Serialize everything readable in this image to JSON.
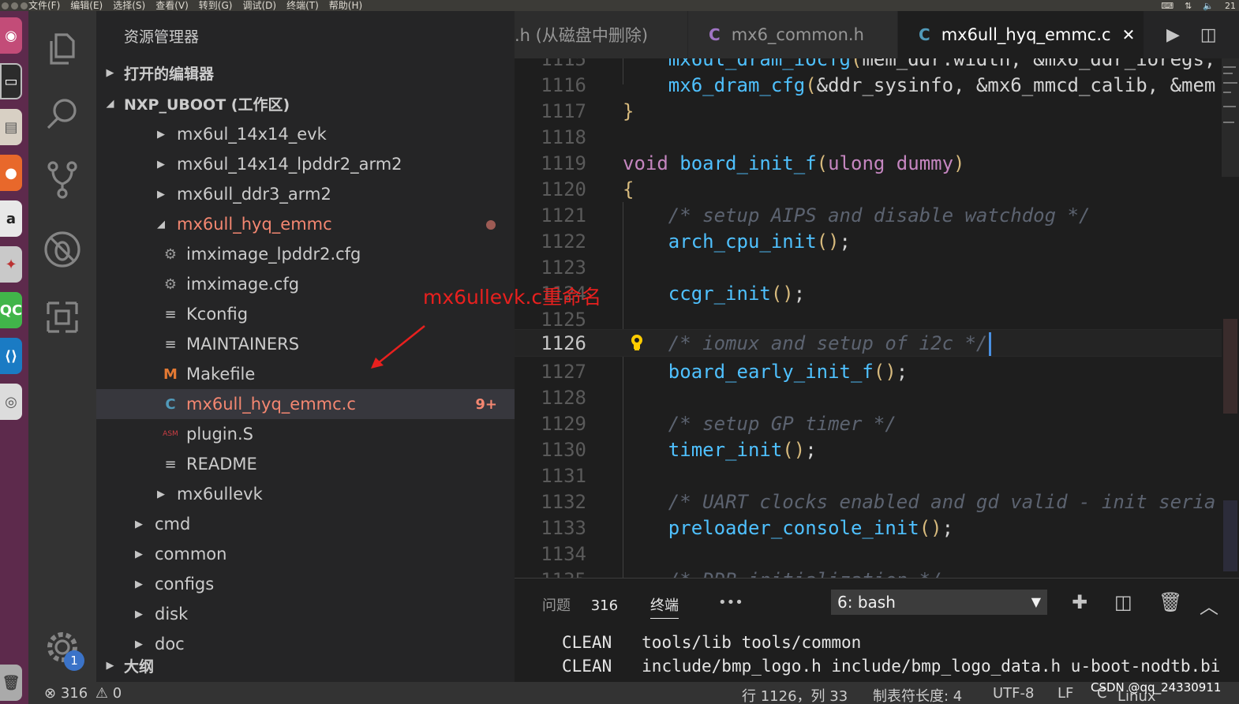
{
  "menubar": {
    "items": [
      "文件(F)",
      "编辑(E)",
      "选择(S)",
      "查看(V)",
      "转到(G)",
      "调试(D)",
      "终端(T)",
      "帮助(H)"
    ],
    "tray_time": "21"
  },
  "sidebar": {
    "title": "资源管理器",
    "open_editors_label": "打开的编辑器",
    "workspace_label": "NXP_UBOOT (工作区)",
    "tree": [
      {
        "label": "mx6ul_14x14_evk",
        "type": "folder",
        "expanded": false
      },
      {
        "label": "mx6ul_14x14_lpddr2_arm2",
        "type": "folder",
        "expanded": false
      },
      {
        "label": "mx6ull_ddr3_arm2",
        "type": "folder",
        "expanded": false
      },
      {
        "label": "mx6ull_hyq_emmc",
        "type": "folder",
        "expanded": true,
        "modified": true
      },
      {
        "label": "imximage_lpddr2.cfg",
        "type": "cfg"
      },
      {
        "label": "imximage.cfg",
        "type": "cfg"
      },
      {
        "label": "Kconfig",
        "type": "text"
      },
      {
        "label": "MAINTAINERS",
        "type": "text"
      },
      {
        "label": "Makefile",
        "type": "makefile",
        "icon_text": "M"
      },
      {
        "label": "mx6ull_hyq_emmc.c",
        "type": "c",
        "icon_text": "C",
        "selected": true,
        "problems": "9+"
      },
      {
        "label": "plugin.S",
        "type": "asm",
        "icon_text": "ASM"
      },
      {
        "label": "README",
        "type": "text"
      },
      {
        "label": "mx6ullevk",
        "type": "folder",
        "expanded": false
      },
      {
        "label": "cmd",
        "type": "folder",
        "expanded": false
      },
      {
        "label": "common",
        "type": "folder",
        "expanded": false
      },
      {
        "label": "configs",
        "type": "folder",
        "expanded": false
      },
      {
        "label": "disk",
        "type": "folder",
        "expanded": false
      },
      {
        "label": "doc",
        "type": "folder",
        "expanded": false
      }
    ],
    "outline_label": "大纲",
    "annotation": "mx6ullevk.c重命名"
  },
  "activity": {
    "badge": "1"
  },
  "tabs": [
    {
      "label": ".h (从磁盘中删除)",
      "icon_text": "",
      "active": false
    },
    {
      "label": "mx6_common.h",
      "icon_text": "C",
      "active": false
    },
    {
      "label": "mx6ull_hyq_emmc.c",
      "icon_text": "C",
      "active": true,
      "close": "✕"
    }
  ],
  "editor": {
    "current_line": 1126
  },
  "panel": {
    "problems_label": "问题",
    "problems_count": "316",
    "terminal_label": "终端",
    "more_label": "•••",
    "terminal_select": "6: bash",
    "terminal_lines": [
      {
        "cmd": "CLEAN",
        "args": "tools/lib tools/common"
      },
      {
        "cmd": "CLEAN",
        "args": "include/bmp_logo.h include/bmp_logo_data.h u-boot-nodtb.bi"
      }
    ]
  },
  "statusbar": {
    "errors": "316",
    "warnings": "0",
    "position": "行 1126，列 33",
    "tab_size": "制表符长度: 4",
    "encoding": "UTF-8",
    "eol": "LF",
    "language": "C",
    "platform": "Linux"
  },
  "watermark": "CSDN @qq_24330911"
}
